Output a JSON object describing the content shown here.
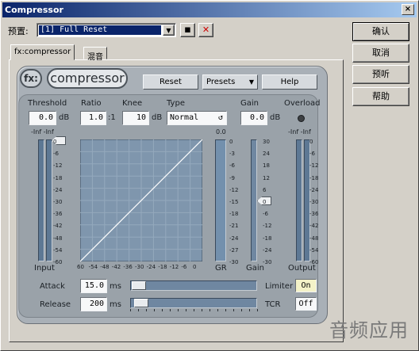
{
  "window": {
    "title": "Compressor",
    "close_glyph": "×"
  },
  "preset": {
    "label": "预置:",
    "value": "[1] Full Reset",
    "dropdown_glyph": "▼",
    "save_glyph": "▪",
    "delete_glyph": "✕"
  },
  "buttons": {
    "ok": "确认",
    "cancel": "取消",
    "preview": "预听",
    "help": "帮助"
  },
  "tabs": [
    {
      "label": "fx:compressor"
    },
    {
      "label": "混音"
    }
  ],
  "plugin": {
    "logo_fx": "fx:",
    "logo_name": "compressor",
    "reset": "Reset",
    "presets": "Presets",
    "presets_arrow": "▼",
    "help": "Help",
    "threshold": {
      "label": "Threshold",
      "value": "0.0",
      "unit": "dB"
    },
    "ratio": {
      "label": "Ratio",
      "value": "1.0",
      "unit": ":1"
    },
    "knee": {
      "label": "Knee",
      "value": "10",
      "unit": "dB"
    },
    "type": {
      "label": "Type",
      "value": "Normal",
      "icon": "↺"
    },
    "gain": {
      "label": "Gain",
      "value": "0.0",
      "unit": "dB"
    },
    "overload": {
      "label": "Overload"
    },
    "input_label": "Input",
    "gr_label": "GR",
    "gain_meter_label": "Gain",
    "output_label": "Output",
    "input_top": "-Inf -Inf",
    "gr_top": "0.0",
    "output_top": "-Inf -Inf",
    "db_scale": [
      "0",
      "-6",
      "-12",
      "-18",
      "-24",
      "-30",
      "-36",
      "-42",
      "-48",
      "-54",
      "-60"
    ],
    "gr_scale": [
      "0",
      "-3",
      "-6",
      "-9",
      "-12",
      "-15",
      "-18",
      "-21",
      "-24",
      "-27",
      "-30"
    ],
    "gain_scale": [
      "30",
      "24",
      "18",
      "12",
      "6",
      "0",
      "-6",
      "-12",
      "-18",
      "-24",
      "-30"
    ],
    "graph_x": [
      "60",
      "-54",
      "-48",
      "-42",
      "-36",
      "-30",
      "-24",
      "-18",
      "-12",
      "-6",
      "0"
    ],
    "attack": {
      "label": "Attack",
      "value": "15.0",
      "unit": "ms"
    },
    "release": {
      "label": "Release",
      "value": "200",
      "unit": "ms"
    },
    "limiter": {
      "label": "Limiter",
      "value": "On"
    },
    "tcr": {
      "label": "TCR",
      "value": "Off"
    }
  },
  "watermark": "音频应用"
}
